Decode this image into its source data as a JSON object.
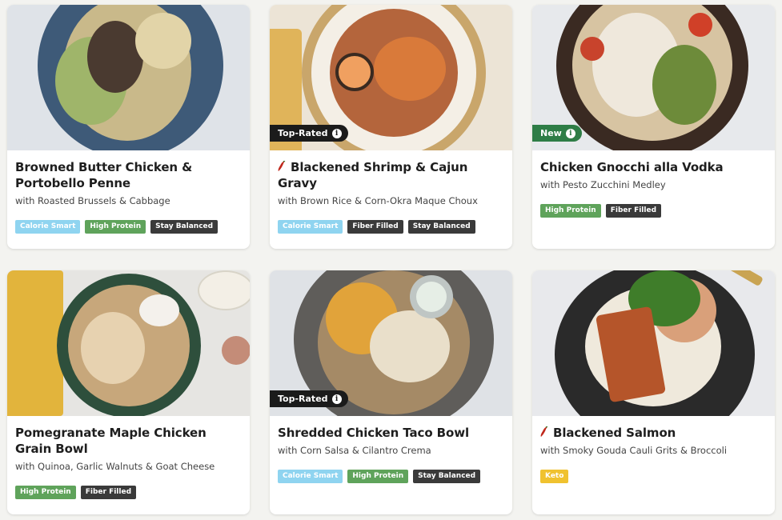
{
  "meals": [
    {
      "title": "Browned Butter Chicken & Portobello Penne",
      "subtitle": "with Roasted Brussels & Cabbage",
      "spicy": false,
      "badge": null,
      "tags": [
        "Calorie Smart",
        "High Protein",
        "Stay Balanced"
      ]
    },
    {
      "title": "Blackened Shrimp & Cajun Gravy",
      "subtitle": "with Brown Rice & Corn-Okra Maque Choux",
      "spicy": true,
      "badge": "Top-Rated",
      "tags": [
        "Calorie Smart",
        "Fiber Filled",
        "Stay Balanced"
      ]
    },
    {
      "title": "Chicken Gnocchi alla Vodka",
      "subtitle": "with Pesto Zucchini Medley",
      "spicy": false,
      "badge": "New",
      "tags": [
        "High Protein",
        "Fiber Filled"
      ]
    },
    {
      "title": "Pomegranate Maple Chicken Grain Bowl",
      "subtitle": "with Quinoa, Garlic Walnuts & Goat Cheese",
      "spicy": false,
      "badge": null,
      "tags": [
        "High Protein",
        "Fiber Filled"
      ]
    },
    {
      "title": "Shredded Chicken Taco Bowl",
      "subtitle": "with Corn Salsa & Cilantro Crema",
      "spicy": false,
      "badge": "Top-Rated",
      "tags": [
        "Calorie Smart",
        "High Protein",
        "Stay Balanced"
      ]
    },
    {
      "title": "Blackened Salmon",
      "subtitle": "with Smoky Gouda Cauli Grits & Broccoli",
      "spicy": true,
      "badge": null,
      "tags": [
        "Keto"
      ]
    }
  ],
  "badge_info_glyph": "i",
  "tag_colors": {
    "Calorie Smart": "#8fd4f0",
    "High Protein": "#5fa35b",
    "Stay Balanced": "#3a3a3a",
    "Fiber Filled": "#3a3a3a",
    "Keto": "#f0c22f"
  },
  "badge_colors": {
    "Top-Rated": "#1b1b1b",
    "New": "#2e7d46"
  },
  "icons": {
    "spicy": "chili-pepper-icon",
    "info": "info-icon"
  }
}
